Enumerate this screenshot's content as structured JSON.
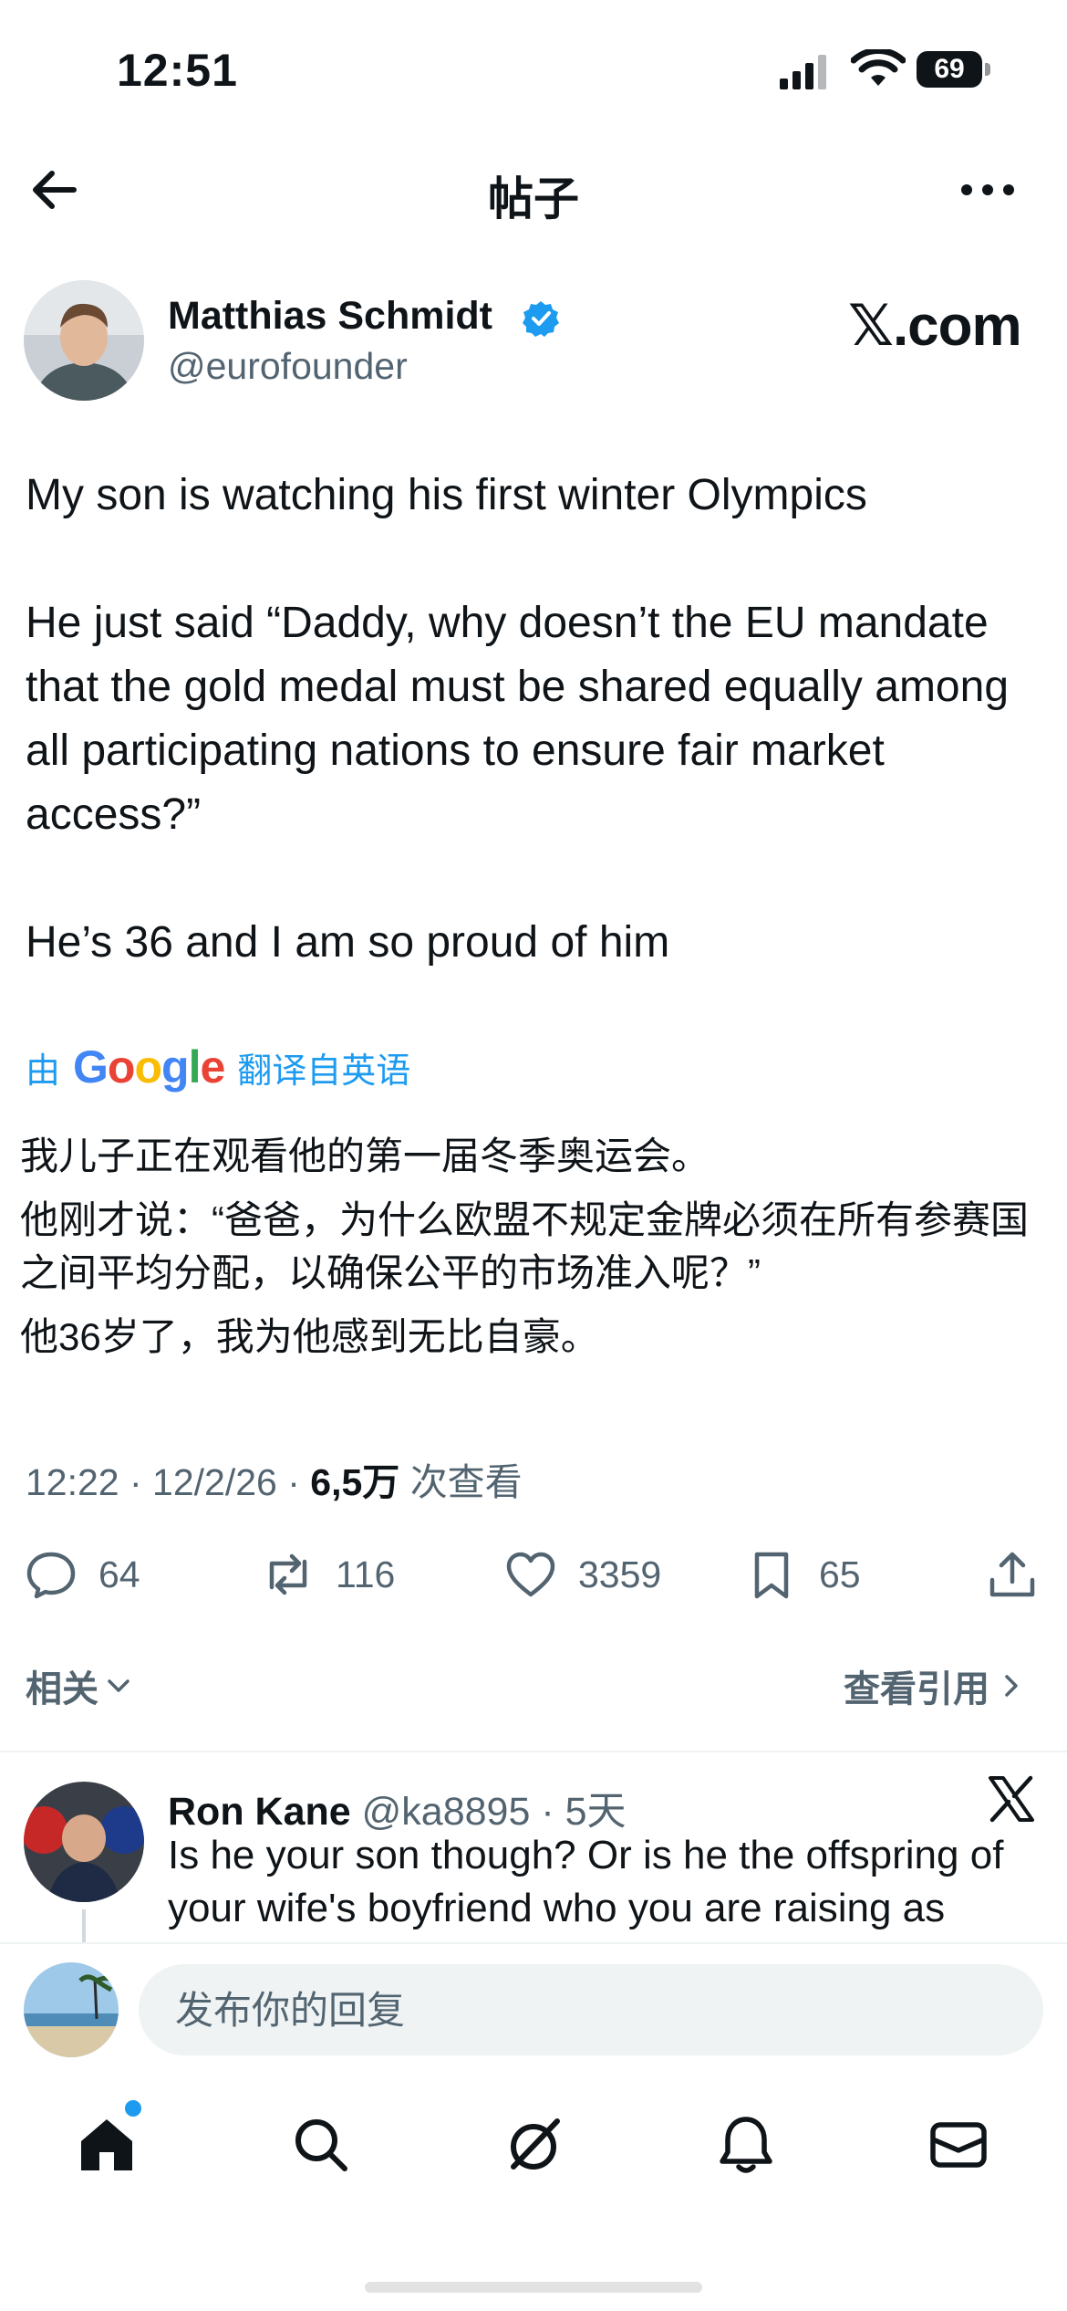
{
  "status_bar": {
    "time": "12:51",
    "battery": "69"
  },
  "header": {
    "title": "帖子"
  },
  "author": {
    "name": "Matthias Schmidt",
    "handle": "@eurofounder",
    "brand": "𝕏.com"
  },
  "tweet": {
    "paragraphs": [
      "My son is watching his first winter Olympics",
      "He just said “Daddy, why doesn’t the EU mandate that the gold medal must be shared equally among all participating nations to ensure fair market access?”",
      "He’s 36 and I am so proud of him"
    ]
  },
  "translation": {
    "prefix": "由",
    "provider": "Google",
    "suffix": "翻译自英语",
    "paragraphs": [
      "我儿子正在观看他的第一届冬季奥运会。",
      "他刚才说：“爸爸，为什么欧盟不规定金牌必须在所有参赛国之间平均分配，以确保公平的市场准入呢？”",
      "他36岁了，我为他感到无比自豪。"
    ]
  },
  "meta": {
    "time": "12:22",
    "date": "12/2/26",
    "views": "6,5万",
    "views_label": "次查看"
  },
  "actions": {
    "replies": "64",
    "reposts": "116",
    "likes": "3359",
    "bookmarks": "65"
  },
  "related": {
    "label": "相关",
    "quotes_label": "查看引用"
  },
  "reply": {
    "name": "Ron Kane",
    "handle": "@ka8895",
    "age": "5天",
    "text": "Is he your son though? Or is he the offspring of your wife's boyfriend who you are raising as"
  },
  "composer": {
    "placeholder": "发布你的回复"
  },
  "colors": {
    "accent": "#1d9bf0",
    "text": "#0f1419",
    "secondary": "#536471"
  },
  "tabs": [
    "home-icon",
    "search-icon",
    "grok-icon",
    "notifications-icon",
    "messages-icon"
  ]
}
